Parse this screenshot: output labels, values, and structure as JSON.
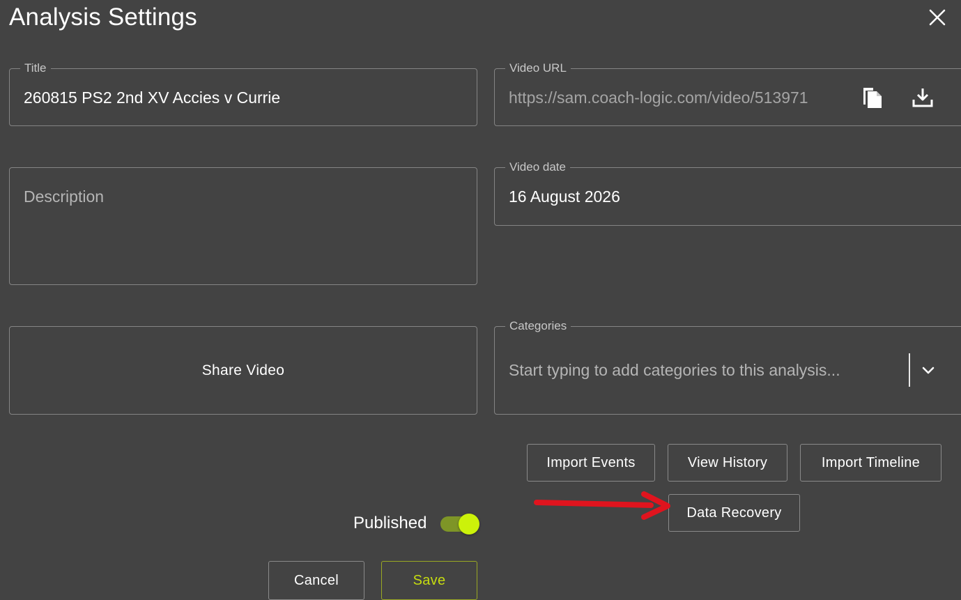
{
  "dialog": {
    "title": "Analysis Settings",
    "close_icon": "close-icon"
  },
  "title_field": {
    "label": "Title",
    "value": "260815 PS2 2nd XV Accies v Currie"
  },
  "video_url_field": {
    "label": "Video URL",
    "value": "https://sam.coach-logic.com/video/513971",
    "copy_icon": "copy-icon",
    "download_icon": "download-icon"
  },
  "description_field": {
    "placeholder": "Description"
  },
  "video_date_field": {
    "label": "Video date",
    "value": "16 August 2026"
  },
  "share_video": {
    "label": "Share Video"
  },
  "categories_field": {
    "label": "Categories",
    "placeholder": "Start typing to add categories to this analysis...",
    "dropdown_icon": "chevron-down-icon"
  },
  "actions": {
    "import_events": "Import Events",
    "view_history": "View History",
    "import_timeline": "Import Timeline",
    "data_recovery": "Data Recovery"
  },
  "published": {
    "label": "Published",
    "enabled": true
  },
  "footer": {
    "cancel": "Cancel",
    "save": "Save"
  },
  "colors": {
    "background": "#434343",
    "accent": "#ccf20a",
    "annotation_arrow": "#e0141e"
  }
}
